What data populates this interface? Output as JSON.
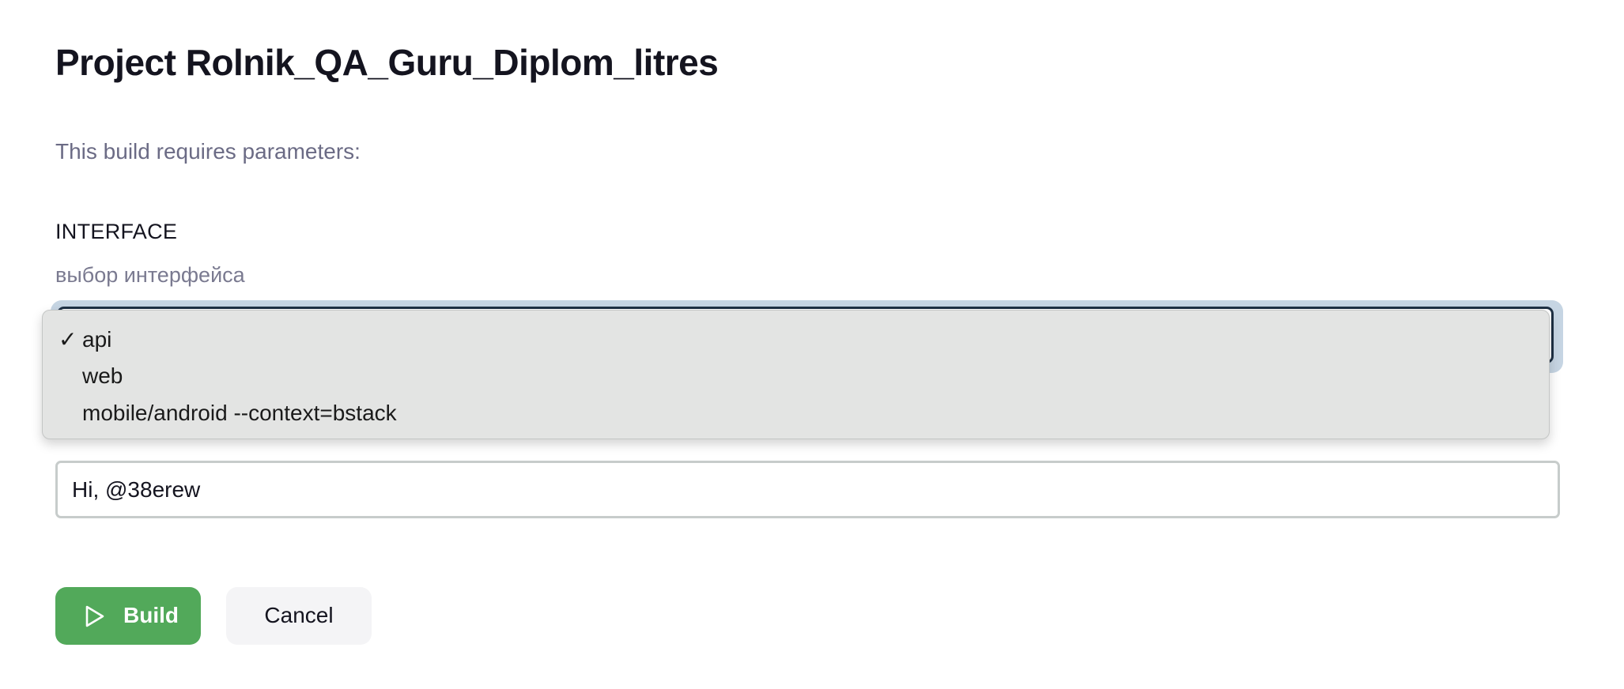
{
  "page": {
    "title": "Project Rolnik_QA_Guru_Diplom_litres",
    "intro": "This build requires parameters:"
  },
  "parameter": {
    "name": "INTERFACE",
    "description": "выбор интерфейса",
    "selected": "api",
    "check_mark": "✓",
    "options": [
      {
        "label": "api",
        "selected": true
      },
      {
        "label": "web",
        "selected": false
      },
      {
        "label": "mobile/android --context=bstack",
        "selected": false
      }
    ]
  },
  "comment_input": {
    "value": "Hi, @38erew"
  },
  "actions": {
    "build_label": "Build",
    "build_icon": "play-icon",
    "cancel_label": "Cancel"
  },
  "colors": {
    "build_button": "#52a95a",
    "focus_ring": "#c6d5e3",
    "select_border": "#1e3044"
  }
}
